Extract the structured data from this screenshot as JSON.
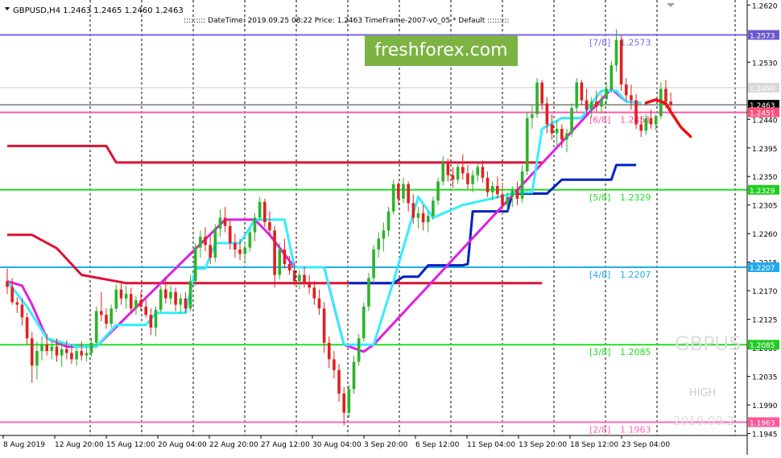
{
  "header": {
    "symbol_line": "GBPUSD,H4  1.2463 1.2465 1.2460 1.2463",
    "info_line": "::::::::: DateTime: 2019.09.25 08:22    Price: 1.2463    TimeFrame-2007-v0_05    *  Default  :::::::::"
  },
  "brand": {
    "text": "freshforex.com",
    "color": "#7cb342"
  },
  "watermark": {
    "symbol": "GBPUS",
    "high_label": "HIGH",
    "date": "2019.09.2"
  },
  "colors": {
    "candle_up": "#2bb32b",
    "candle_down": "#e02020",
    "cyan": "#33eeff",
    "magenta": "#e020e0",
    "red": "#dd1133",
    "blue": "#0020c0"
  },
  "chart_data": {
    "type": "candlestick",
    "symbol": "GBPUSD",
    "timeframe": "H4",
    "ylim": [
      1.1942,
      1.2628
    ],
    "y_ticks": [
      1.262,
      1.2573,
      1.253,
      1.249,
      1.2463,
      1.2451,
      1.244,
      1.2395,
      1.235,
      1.2329,
      1.2305,
      1.226,
      1.2215,
      1.2207,
      1.217,
      1.2125,
      1.2085,
      1.208,
      1.2035,
      1.199,
      1.1963,
      1.1945
    ],
    "x_ticks": [
      "8 Aug 2019",
      "12 Aug 20:00",
      "15 Aug 12:00",
      "20 Aug 04:00",
      "22 Aug 20:00",
      "27 Aug 12:00",
      "30 Aug 04:00",
      "3 Sep 20:00",
      "6 Sep 12:00",
      "11 Sep 04:00",
      "13 Sep 20:00",
      "18 Sep 12:00",
      "23 Sep 04:00"
    ],
    "price_badges": [
      {
        "value": "1.2573",
        "bg": "#6a5acd",
        "fg": "#ffffff"
      },
      {
        "value": "1.2490",
        "bg": "#d8d8d8",
        "fg": "#ffffff"
      },
      {
        "value": "1.2463",
        "bg": "#000000",
        "fg": "#ffffff"
      },
      {
        "value": "1.2451",
        "bg": "#ff4f7a",
        "fg": "#ffffff"
      },
      {
        "value": "1.2329",
        "bg": "#22cc22",
        "fg": "#ffffff"
      },
      {
        "value": "1.2207",
        "bg": "#22aaee",
        "fg": "#ffffff"
      },
      {
        "value": "1.2085",
        "bg": "#22cc22",
        "fg": "#ffffff"
      },
      {
        "value": "1.1963",
        "bg": "#ff5599",
        "fg": "#ffffff"
      }
    ],
    "levels": [
      {
        "label": "[7/8]",
        "value": "1.2573",
        "price": 1.2573,
        "color": "#7b68ee"
      },
      {
        "label": "[6/8]",
        "value": "1.2451",
        "price": 1.2451,
        "color": "#ff55aa"
      },
      {
        "label": "[5/8]",
        "value": "1.2329",
        "price": 1.2329,
        "color": "#22dd22"
      },
      {
        "label": "[4/8]",
        "value": "1.2207",
        "price": 1.2207,
        "color": "#22aaee"
      },
      {
        "label": "[3/8]",
        "value": "1.2085",
        "price": 1.2085,
        "color": "#22dd22"
      },
      {
        "label": "[2/8]",
        "value": "1.1963",
        "price": 1.1963,
        "color": "#ff66bb"
      }
    ],
    "hlines": [
      {
        "price": 1.249,
        "color": "#cccccc"
      },
      {
        "price": 1.2463,
        "color": "#333333"
      }
    ],
    "red_steps": [
      [
        0,
        1.2398
      ],
      [
        20,
        1.2398
      ],
      [
        22,
        1.2372
      ],
      [
        108,
        1.2372
      ]
    ],
    "red_steps_low": [
      [
        0,
        1.2258
      ],
      [
        5,
        1.2258
      ],
      [
        10,
        1.2237
      ],
      [
        15,
        1.2195
      ],
      [
        24,
        1.2182
      ],
      [
        108,
        1.2182
      ]
    ],
    "blue_steps": [
      [
        69,
        1.2182
      ],
      [
        78,
        1.2182
      ],
      [
        80,
        1.2192
      ],
      [
        83,
        1.2192
      ],
      [
        85,
        1.221
      ],
      [
        92,
        1.221
      ],
      [
        93,
        1.2212
      ],
      [
        94,
        1.2295
      ],
      [
        101,
        1.2295
      ],
      [
        102,
        1.2323
      ],
      [
        109,
        1.2323
      ],
      [
        112,
        1.2345
      ],
      [
        122,
        1.2345
      ],
      [
        123,
        1.2368
      ],
      [
        127,
        1.2368
      ]
    ],
    "cyan_line": [
      [
        0,
        1.2185
      ],
      [
        4,
        1.2145
      ],
      [
        8,
        1.2095
      ],
      [
        14,
        1.2082
      ],
      [
        18,
        1.2082
      ],
      [
        22,
        1.2116
      ],
      [
        28,
        1.2116
      ],
      [
        30,
        1.2135
      ],
      [
        36,
        1.2135
      ],
      [
        38,
        1.2205
      ],
      [
        40,
        1.2205
      ],
      [
        42,
        1.2245
      ],
      [
        47,
        1.2245
      ],
      [
        50,
        1.2282
      ],
      [
        56,
        1.2282
      ],
      [
        58,
        1.2207
      ],
      [
        64,
        1.2207
      ],
      [
        68,
        1.2085
      ],
      [
        74,
        1.2085
      ],
      [
        78,
        1.2185
      ],
      [
        83,
        1.2318
      ],
      [
        86,
        1.2285
      ],
      [
        92,
        1.2305
      ],
      [
        96,
        1.2312
      ],
      [
        103,
        1.2325
      ],
      [
        106,
        1.2325
      ],
      [
        108,
        1.2425
      ],
      [
        112,
        1.2442
      ],
      [
        116,
        1.2442
      ],
      [
        118,
        1.2465
      ],
      [
        120,
        1.2485
      ],
      [
        123,
        1.2485
      ],
      [
        125,
        1.2468
      ],
      [
        128,
        1.2466
      ]
    ],
    "magenta_line": [
      [
        0,
        1.2185
      ],
      [
        3,
        1.2178
      ],
      [
        5,
        1.2148
      ],
      [
        8,
        1.2095
      ],
      [
        12,
        1.2082
      ],
      [
        18,
        1.2082
      ],
      [
        44,
        1.2282
      ],
      [
        50,
        1.2282
      ],
      [
        53,
        1.2258
      ],
      [
        58,
        1.2207
      ],
      [
        64,
        1.2207
      ],
      [
        66,
        1.2145
      ],
      [
        68,
        1.2085
      ],
      [
        72,
        1.2074
      ],
      [
        74,
        1.2085
      ],
      [
        122,
        1.2488
      ],
      [
        125,
        1.2468
      ],
      [
        128,
        1.2466
      ]
    ],
    "forecast": [
      [
        129,
        1.2466
      ],
      [
        131,
        1.2471
      ],
      [
        133,
        1.2465
      ],
      [
        134,
        1.2452
      ],
      [
        136,
        1.2428
      ],
      [
        138,
        1.2413
      ]
    ],
    "candles": [
      [
        1.2185,
        1.2205,
        1.2165,
        1.2176
      ],
      [
        1.2176,
        1.219,
        1.2148,
        1.2152
      ],
      [
        1.2152,
        1.216,
        1.2135,
        1.2148
      ],
      [
        1.2148,
        1.2158,
        1.2115,
        1.2128
      ],
      [
        1.2128,
        1.2135,
        1.2085,
        1.2095
      ],
      [
        1.2095,
        1.2105,
        1.2025,
        1.2052
      ],
      [
        1.2052,
        1.209,
        1.203,
        1.2075
      ],
      [
        1.2075,
        1.2098,
        1.206,
        1.2085
      ],
      [
        1.2085,
        1.2102,
        1.2068,
        1.2075
      ],
      [
        1.2075,
        1.2092,
        1.2062,
        1.2082
      ],
      [
        1.2082,
        1.2095,
        1.2058,
        1.2068
      ],
      [
        1.2068,
        1.2088,
        1.205,
        1.2078
      ],
      [
        1.2078,
        1.2092,
        1.2062,
        1.2072
      ],
      [
        1.2072,
        1.2086,
        1.2055,
        1.2062
      ],
      [
        1.2062,
        1.208,
        1.2052,
        1.2075
      ],
      [
        1.2075,
        1.209,
        1.206,
        1.2068
      ],
      [
        1.2068,
        1.2082,
        1.2058,
        1.2072
      ],
      [
        1.2072,
        1.2096,
        1.2066,
        1.2088
      ],
      [
        1.2088,
        1.2145,
        1.2084,
        1.2138
      ],
      [
        1.2138,
        1.2168,
        1.2122,
        1.2132
      ],
      [
        1.2132,
        1.2142,
        1.211,
        1.2118
      ],
      [
        1.2118,
        1.2148,
        1.2112,
        1.2142
      ],
      [
        1.2142,
        1.218,
        1.2136,
        1.2172
      ],
      [
        1.2172,
        1.2185,
        1.2148,
        1.2158
      ],
      [
        1.2158,
        1.2178,
        1.2142,
        1.2165
      ],
      [
        1.2165,
        1.2175,
        1.2135,
        1.2142
      ],
      [
        1.2142,
        1.2162,
        1.2132,
        1.2155
      ],
      [
        1.2155,
        1.2168,
        1.2138,
        1.2145
      ],
      [
        1.2145,
        1.2158,
        1.2128,
        1.2132
      ],
      [
        1.2132,
        1.2142,
        1.21,
        1.2112
      ],
      [
        1.2112,
        1.2145,
        1.2098,
        1.214
      ],
      [
        1.214,
        1.2178,
        1.2136,
        1.2172
      ],
      [
        1.2172,
        1.2192,
        1.215,
        1.2158
      ],
      [
        1.2158,
        1.2178,
        1.2148,
        1.2168
      ],
      [
        1.2168,
        1.2175,
        1.2138,
        1.2148
      ],
      [
        1.2148,
        1.2165,
        1.2135,
        1.2158
      ],
      [
        1.2158,
        1.2168,
        1.2135,
        1.2142
      ],
      [
        1.2142,
        1.2195,
        1.2138,
        1.2185
      ],
      [
        1.2185,
        1.2245,
        1.2178,
        1.2238
      ],
      [
        1.2238,
        1.2265,
        1.2222,
        1.2255
      ],
      [
        1.2255,
        1.227,
        1.2232,
        1.2242
      ],
      [
        1.2242,
        1.2258,
        1.2212,
        1.2222
      ],
      [
        1.2222,
        1.2275,
        1.2215,
        1.2268
      ],
      [
        1.2268,
        1.2298,
        1.2255,
        1.2285
      ],
      [
        1.2285,
        1.2302,
        1.2262,
        1.2272
      ],
      [
        1.2272,
        1.2282,
        1.2235,
        1.2245
      ],
      [
        1.2245,
        1.226,
        1.2222,
        1.2235
      ],
      [
        1.2235,
        1.2252,
        1.2218,
        1.2228
      ],
      [
        1.2228,
        1.2248,
        1.2215,
        1.2238
      ],
      [
        1.2238,
        1.2268,
        1.2232,
        1.2262
      ],
      [
        1.2262,
        1.2292,
        1.2248,
        1.2285
      ],
      [
        1.2285,
        1.2318,
        1.228,
        1.231
      ],
      [
        1.231,
        1.2315,
        1.227,
        1.2278
      ],
      [
        1.2278,
        1.2295,
        1.2258,
        1.2265
      ],
      [
        1.2265,
        1.2272,
        1.2175,
        1.2195
      ],
      [
        1.2195,
        1.2245,
        1.2188,
        1.2235
      ],
      [
        1.2235,
        1.2252,
        1.2205,
        1.2212
      ],
      [
        1.2212,
        1.2225,
        1.2195,
        1.2202
      ],
      [
        1.2202,
        1.2215,
        1.2178,
        1.2185
      ],
      [
        1.2185,
        1.2202,
        1.2172,
        1.2195
      ],
      [
        1.2195,
        1.2208,
        1.2175,
        1.2182
      ],
      [
        1.2182,
        1.2195,
        1.2165,
        1.2175
      ],
      [
        1.2175,
        1.2185,
        1.2148,
        1.2158
      ],
      [
        1.2158,
        1.2172,
        1.2132,
        1.2142
      ],
      [
        1.2142,
        1.2152,
        1.2072,
        1.2088
      ],
      [
        1.2088,
        1.2098,
        1.2048,
        1.2062
      ],
      [
        1.2062,
        1.2075,
        1.2032,
        1.2045
      ],
      [
        1.2045,
        1.2055,
        1.1995,
        1.2008
      ],
      [
        1.2008,
        1.2018,
        1.1958,
        1.1978
      ],
      [
        1.1978,
        1.2022,
        1.197,
        1.2015
      ],
      [
        1.2015,
        1.2068,
        1.2008,
        1.2058
      ],
      [
        1.2058,
        1.2102,
        1.2052,
        1.2095
      ],
      [
        1.2095,
        1.2152,
        1.209,
        1.2145
      ],
      [
        1.2145,
        1.2198,
        1.2138,
        1.219
      ],
      [
        1.219,
        1.2242,
        1.2182,
        1.2235
      ],
      [
        1.2235,
        1.2262,
        1.2222,
        1.2252
      ],
      [
        1.2252,
        1.2278,
        1.2232,
        1.2265
      ],
      [
        1.2265,
        1.2302,
        1.2255,
        1.2295
      ],
      [
        1.2295,
        1.2345,
        1.229,
        1.2338
      ],
      [
        1.2338,
        1.2342,
        1.2305,
        1.2315
      ],
      [
        1.2315,
        1.2348,
        1.2308,
        1.2338
      ],
      [
        1.2338,
        1.2342,
        1.2295,
        1.2308
      ],
      [
        1.2308,
        1.2322,
        1.2275,
        1.2285
      ],
      [
        1.2285,
        1.2302,
        1.2268,
        1.2292
      ],
      [
        1.2292,
        1.2305,
        1.2265,
        1.2278
      ],
      [
        1.2278,
        1.2295,
        1.2262,
        1.2288
      ],
      [
        1.2288,
        1.2318,
        1.2282,
        1.2312
      ],
      [
        1.2312,
        1.2348,
        1.2305,
        1.2342
      ],
      [
        1.2342,
        1.2382,
        1.2335,
        1.2372
      ],
      [
        1.2372,
        1.2378,
        1.2342,
        1.2352
      ],
      [
        1.2352,
        1.2365,
        1.2332,
        1.2345
      ],
      [
        1.2345,
        1.2372,
        1.2338,
        1.2365
      ],
      [
        1.2365,
        1.2385,
        1.2345,
        1.2355
      ],
      [
        1.2355,
        1.2368,
        1.233,
        1.2338
      ],
      [
        1.2338,
        1.236,
        1.2325,
        1.2352
      ],
      [
        1.2352,
        1.2372,
        1.2342,
        1.2365
      ],
      [
        1.2365,
        1.2375,
        1.234,
        1.2348
      ],
      [
        1.2348,
        1.2358,
        1.2318,
        1.2325
      ],
      [
        1.2325,
        1.2342,
        1.2312,
        1.2335
      ],
      [
        1.2335,
        1.235,
        1.2315,
        1.2322
      ],
      [
        1.2322,
        1.234,
        1.229,
        1.2305
      ],
      [
        1.2305,
        1.2325,
        1.2295,
        1.2318
      ],
      [
        1.2318,
        1.2335,
        1.2302,
        1.2328
      ],
      [
        1.2328,
        1.2342,
        1.2305,
        1.2315
      ],
      [
        1.2315,
        1.2368,
        1.2308,
        1.2358
      ],
      [
        1.2358,
        1.2452,
        1.2352,
        1.2442
      ],
      [
        1.2442,
        1.2462,
        1.2425,
        1.2448
      ],
      [
        1.2448,
        1.2505,
        1.2442,
        1.2498
      ],
      [
        1.2498,
        1.2502,
        1.2455,
        1.2465
      ],
      [
        1.2465,
        1.2475,
        1.2418,
        1.2432
      ],
      [
        1.2432,
        1.2448,
        1.2408,
        1.2418
      ],
      [
        1.2418,
        1.2438,
        1.2398,
        1.2425
      ],
      [
        1.2425,
        1.2432,
        1.2395,
        1.2408
      ],
      [
        1.2408,
        1.2425,
        1.2388,
        1.2418
      ],
      [
        1.2418,
        1.2465,
        1.2412,
        1.2458
      ],
      [
        1.2458,
        1.2505,
        1.2452,
        1.2498
      ],
      [
        1.2498,
        1.2502,
        1.2462,
        1.247
      ],
      [
        1.247,
        1.2488,
        1.2445,
        1.2455
      ],
      [
        1.2455,
        1.2475,
        1.2442,
        1.2468
      ],
      [
        1.2468,
        1.2485,
        1.2452,
        1.246
      ],
      [
        1.246,
        1.248,
        1.245,
        1.2472
      ],
      [
        1.2472,
        1.2498,
        1.2462,
        1.2488
      ],
      [
        1.2488,
        1.2532,
        1.2482,
        1.2525
      ],
      [
        1.2525,
        1.2582,
        1.2515,
        1.2565
      ],
      [
        1.2565,
        1.2572,
        1.2485,
        1.2495
      ],
      [
        1.2495,
        1.2505,
        1.2468,
        1.2478
      ],
      [
        1.2478,
        1.2495,
        1.2455,
        1.247
      ],
      [
        1.247,
        1.248,
        1.2425,
        1.2432
      ],
      [
        1.2432,
        1.2445,
        1.2412,
        1.2422
      ],
      [
        1.2422,
        1.2448,
        1.2415,
        1.2442
      ],
      [
        1.2442,
        1.2455,
        1.2425,
        1.2432
      ],
      [
        1.2432,
        1.2448,
        1.2422,
        1.2445
      ],
      [
        1.2445,
        1.2498,
        1.244,
        1.2488
      ],
      [
        1.2488,
        1.2502,
        1.2458,
        1.2468
      ],
      [
        1.2468,
        1.2482,
        1.2455,
        1.2463
      ]
    ]
  }
}
